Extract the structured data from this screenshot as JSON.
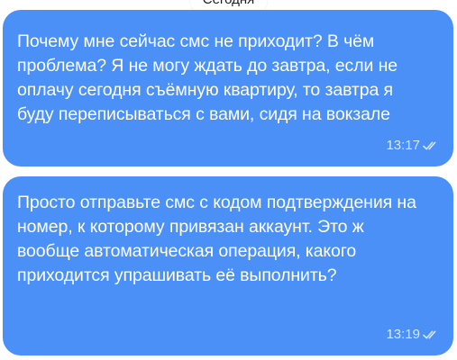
{
  "chat": {
    "date_label": "Сегодня",
    "messages": [
      {
        "text": "Почему мне сейчас смс не приходит? В чём проблема? Я не могу ждать до завтра, если не оплачу сегодня съёмную квартиру, то завтра я буду переписываться с вами, сидя на вокзале",
        "time": "13:17",
        "status_icon": "double-check-icon"
      },
      {
        "text": "Просто отправьте смс с кодом подтверждения на номер, к которому привязан аккаунт. Это ж вообще автоматическая операция, какого приходится упрашивать её выполнить?",
        "time": "13:19",
        "status_icon": "double-check-icon"
      }
    ]
  },
  "colors": {
    "bubble": "#4A90F7",
    "text": "#FFFFFF",
    "meta": "#D8E6FD"
  }
}
